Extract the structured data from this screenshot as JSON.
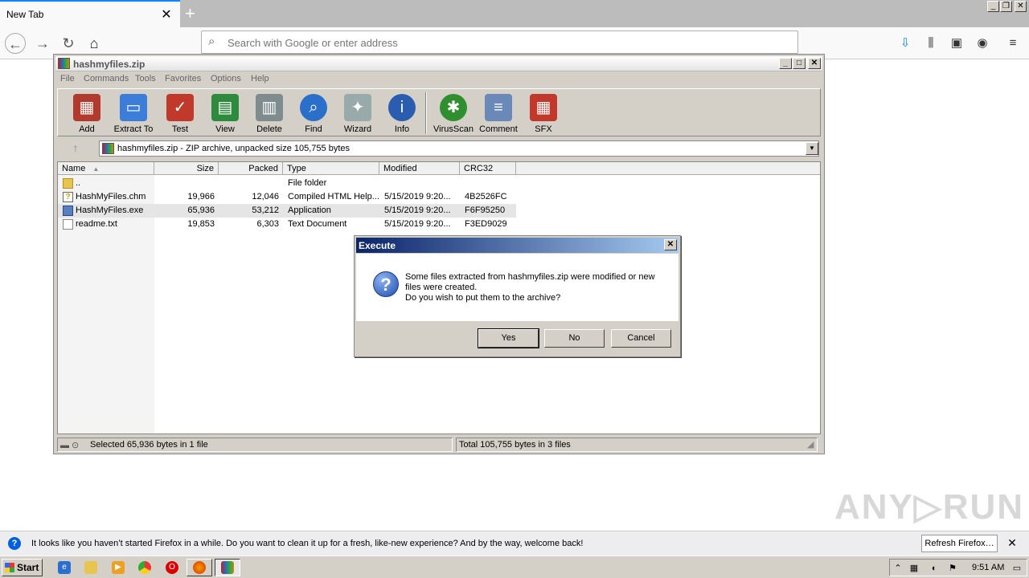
{
  "browser": {
    "tab_title": "New Tab",
    "tab_close": "✕",
    "new_tab": "+",
    "url_placeholder": "Search with Google or enter address",
    "window_controls": [
      "_",
      "❐",
      "✕"
    ]
  },
  "winrar": {
    "title": "hashmyfiles.zip",
    "menu": [
      "File",
      "Commands",
      "Tools",
      "Favorites",
      "Options",
      "Help"
    ],
    "tools": [
      {
        "label": "Add",
        "icon": "add-archive-icon",
        "color": "#b03a2e"
      },
      {
        "label": "Extract To",
        "icon": "extract-folder-icon",
        "color": "#3b7dd8"
      },
      {
        "label": "Test",
        "icon": "test-clipboard-icon",
        "color": "#c0392b"
      },
      {
        "label": "View",
        "icon": "view-book-icon",
        "color": "#2e8b3e"
      },
      {
        "label": "Delete",
        "icon": "trash-icon",
        "color": "#7f8c8d"
      },
      {
        "label": "Find",
        "icon": "magnifier-icon",
        "color": "#2a6fc9"
      },
      {
        "label": "Wizard",
        "icon": "wand-icon",
        "color": "#9aa"
      },
      {
        "label": "Info",
        "icon": "info-icon",
        "color": "#2a5db0"
      },
      {
        "label": "VirusScan",
        "icon": "bug-icon",
        "color": "#2f8f2f"
      },
      {
        "label": "Comment",
        "icon": "comment-icon",
        "color": "#6a88b8"
      },
      {
        "label": "SFX",
        "icon": "sfx-box-icon",
        "color": "#c0392b"
      }
    ],
    "path": "hashmyfiles.zip - ZIP archive, unpacked size 105,755 bytes",
    "columns": [
      "Name",
      "Size",
      "Packed",
      "Type",
      "Modified",
      "CRC32"
    ],
    "files": [
      {
        "name": "..",
        "size": "",
        "packed": "",
        "type": "File folder",
        "modified": "",
        "crc": "",
        "icon": "folder-up-icon"
      },
      {
        "name": "HashMyFiles.chm",
        "size": "19,966",
        "packed": "12,046",
        "type": "Compiled HTML Help...",
        "modified": "5/15/2019 9:20...",
        "crc": "4B2526FC",
        "icon": "help-file-icon"
      },
      {
        "name": "HashMyFiles.exe",
        "size": "65,936",
        "packed": "53,212",
        "type": "Application",
        "modified": "5/15/2019 9:20...",
        "crc": "F6F95250",
        "icon": "application-icon"
      },
      {
        "name": "readme.txt",
        "size": "19,853",
        "packed": "6,303",
        "type": "Text Document",
        "modified": "5/15/2019 9:20...",
        "crc": "F3ED9029",
        "icon": "text-file-icon"
      }
    ],
    "status_left": "Selected 65,936 bytes in 1 file",
    "status_right": "Total 105,755 bytes in 3 files"
  },
  "dialog": {
    "title": "Execute",
    "line1": "Some files extracted from hashmyfiles.zip were modified or new",
    "line2": "files were created.",
    "line3": "Do you wish to put them to the archive?",
    "yes": "Yes",
    "no": "No",
    "cancel": "Cancel"
  },
  "notification": {
    "text": "It looks like you haven’t started Firefox in a while. Do you want to clean it up for a fresh, like-new experience? And by the way, welcome back!",
    "button": "Refresh Firefox…"
  },
  "taskbar": {
    "start": "Start",
    "clock": "9:51 AM"
  },
  "watermark": "ANY▷RUN"
}
